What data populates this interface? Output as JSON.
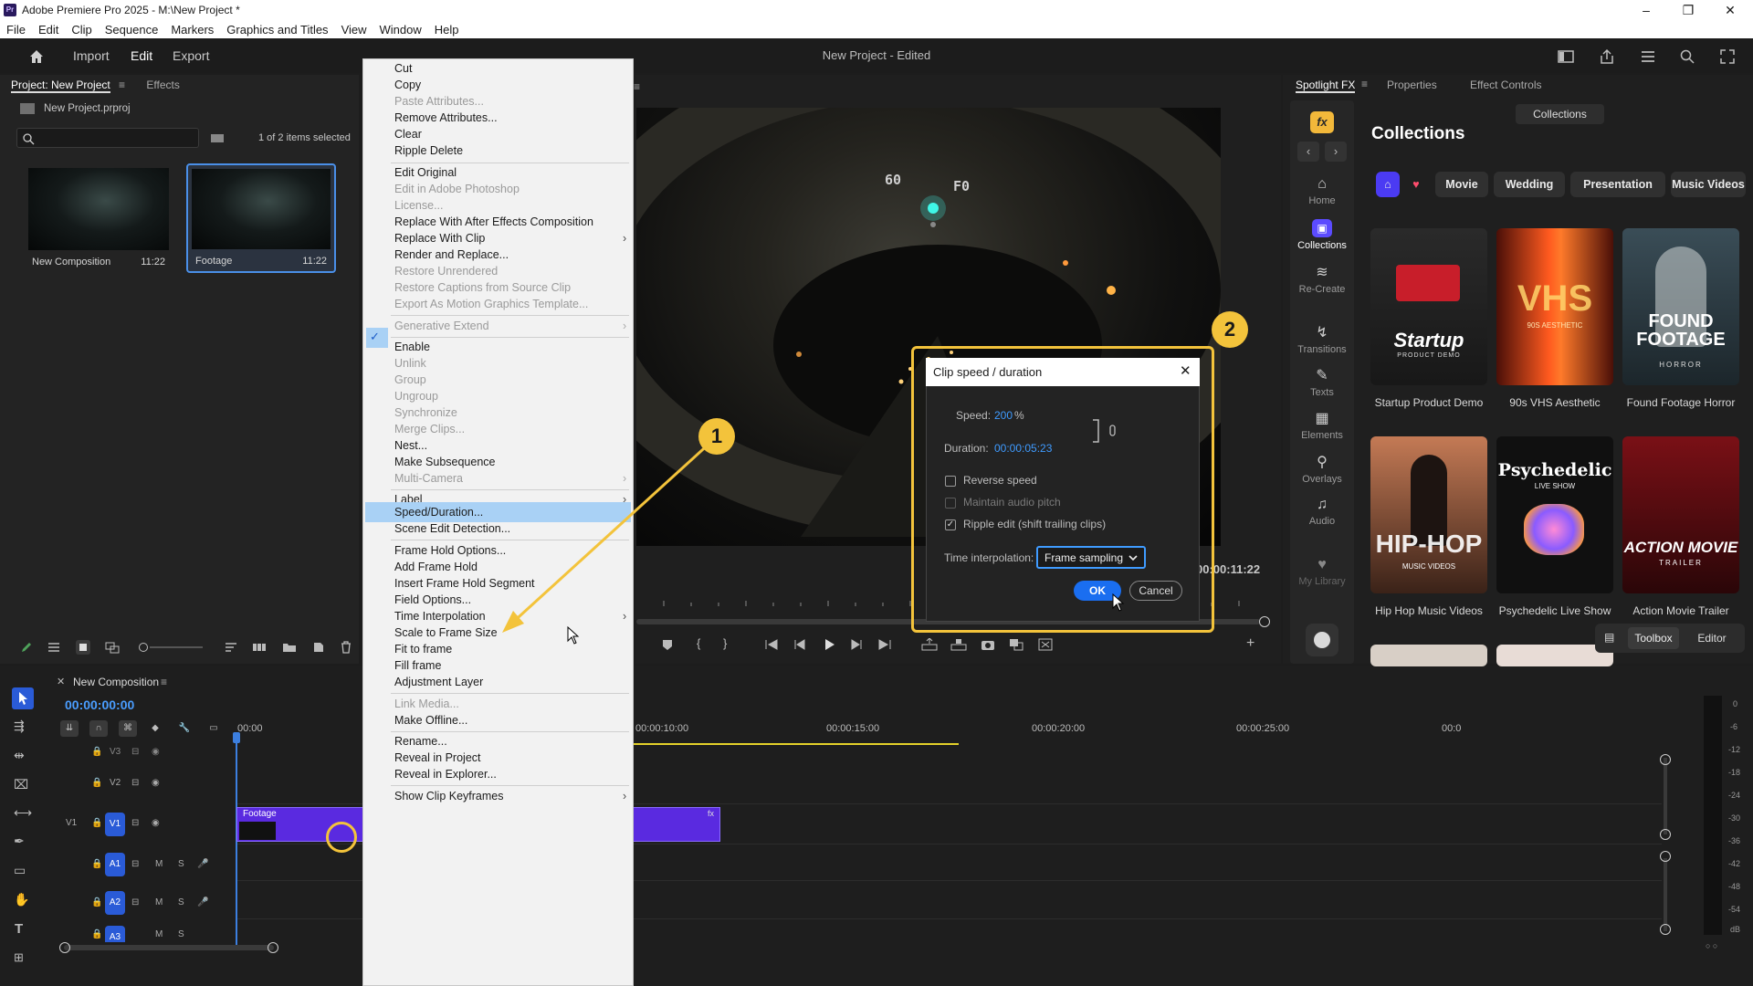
{
  "window": {
    "title": "Adobe Premiere Pro 2025 - M:\\New Project *",
    "logo": "Pr"
  },
  "menubar": [
    "File",
    "Edit",
    "Clip",
    "Sequence",
    "Markers",
    "Graphics and Titles",
    "View",
    "Window",
    "Help"
  ],
  "header": {
    "workspaces": {
      "import": "Import",
      "edit": "Edit",
      "export": "Export"
    },
    "project_title": "New Project - Edited"
  },
  "project_panel": {
    "tab_project": "Project: New Project",
    "tab_effects": "Effects",
    "file": "New Project.prproj",
    "selection_count": "1 of 2 items selected",
    "items": [
      {
        "name": "New Composition",
        "duration": "11:22"
      },
      {
        "name": "Footage",
        "duration": "11:22"
      }
    ]
  },
  "context_menu": {
    "items": {
      "cut": "Cut",
      "copy": "Copy",
      "paste_attr": "Paste Attributes...",
      "remove_attr": "Remove Attributes...",
      "clear": "Clear",
      "ripple_delete": "Ripple Delete",
      "edit_original": "Edit Original",
      "edit_photoshop": "Edit in Adobe Photoshop",
      "license": "License...",
      "replace_ae": "Replace With After Effects Composition",
      "replace_clip": "Replace With Clip",
      "render_replace": "Render and Replace...",
      "restore_unrendered": "Restore Unrendered",
      "restore_captions": "Restore Captions from Source Clip",
      "export_mogrt": "Export As Motion Graphics Template...",
      "generative_extend": "Generative Extend",
      "enable": "Enable",
      "unlink": "Unlink",
      "group": "Group",
      "ungroup": "Ungroup",
      "synchronize": "Synchronize",
      "merge_clips": "Merge Clips...",
      "nest": "Nest...",
      "make_subsequence": "Make Subsequence",
      "multi_camera": "Multi-Camera",
      "label": "Label",
      "speed_duration": "Speed/Duration...",
      "scene_edit": "Scene Edit Detection...",
      "frame_hold_options": "Frame Hold Options...",
      "add_frame_hold": "Add Frame Hold",
      "insert_frame_hold": "Insert Frame Hold Segment",
      "field_options": "Field Options...",
      "time_interpolation": "Time Interpolation",
      "scale_frame": "Scale to Frame Size",
      "fit_frame": "Fit to frame",
      "fill_frame": "Fill frame",
      "adjustment_layer": "Adjustment Layer",
      "link_media": "Link Media...",
      "make_offline": "Make Offline...",
      "rename": "Rename...",
      "reveal_project": "Reveal in Project",
      "reveal_explorer": "Reveal in Explorer...",
      "show_keyframes": "Show Clip Keyframes"
    }
  },
  "monitor": {
    "overlay_60": "60",
    "overlay_f0": "F0",
    "timecode": "00:00:11:22"
  },
  "dialog": {
    "title": "Clip speed / duration",
    "speed_label": "Speed:",
    "speed_value": "200",
    "speed_unit": "%",
    "duration_label": "Duration:",
    "duration_value": "00:00:05:23",
    "reverse_speed": "Reverse speed",
    "reverse_checked": false,
    "maintain_pitch": "Maintain audio pitch",
    "maintain_checked": false,
    "ripple_edit": "Ripple edit (shift trailing clips)",
    "ripple_checked": true,
    "interp_label": "Time interpolation:",
    "interp_value": "Frame sampling",
    "ok": "OK",
    "cancel": "Cancel"
  },
  "annotations": {
    "one": "1",
    "two": "2",
    "color": "#f3c33b"
  },
  "right_panel": {
    "tabs": {
      "spotlight": "Spotlight FX",
      "properties": "Properties",
      "effect_controls": "Effect Controls"
    },
    "collections_btn": "Collections",
    "heading": "Collections",
    "fx_label": "fx",
    "sidebar": [
      {
        "label": "Home",
        "icon": "home-icon"
      },
      {
        "label": "Collections",
        "icon": "collections-icon"
      },
      {
        "label": "Re-Create",
        "icon": "layers-icon"
      },
      {
        "label": "Transitions",
        "icon": "transitions-icon"
      },
      {
        "label": "Texts",
        "icon": "pen-icon"
      },
      {
        "label": "Elements",
        "icon": "elements-icon"
      },
      {
        "label": "Overlays",
        "icon": "overlays-icon"
      },
      {
        "label": "Audio",
        "icon": "music-icon"
      },
      {
        "label": "My Library",
        "icon": "heart-icon"
      }
    ],
    "chips": [
      "Movie",
      "Wedding",
      "Presentation",
      "Music Videos"
    ],
    "cards": [
      {
        "title": "Startup Product Demo",
        "art": "Startup",
        "art_sub": "PRODUCT DEMO"
      },
      {
        "title": "90s VHS Aesthetic",
        "art": "VHS",
        "art_sub": "90S AESTHETIC"
      },
      {
        "title": "Found Footage Horror",
        "art": "FOUND FOOTAGE",
        "art_sub": "HORROR"
      },
      {
        "title": "Hip Hop Music Videos",
        "art": "HIP-HOP",
        "art_sub": "MUSIC VIDEOS"
      },
      {
        "title": "Psychedelic Live Show",
        "art": "Psychedelic",
        "art_sub": "LIVE SHOW"
      },
      {
        "title": "Action Movie Trailer",
        "art": "ACTION MOVIE",
        "art_sub": "TRAILER"
      }
    ],
    "toolbox": "Toolbox",
    "editor": "Editor"
  },
  "timeline": {
    "sequence_name": "New Composition",
    "timecode": "00:00:00:00",
    "ruler": [
      "00:00",
      "00:00:10:00",
      "00:00:15:00",
      "00:00:20:00",
      "00:00:25:00",
      "00:0"
    ],
    "tracks": {
      "v3": "V3",
      "v2": "V2",
      "v1": "V1",
      "a1": "A1",
      "a2": "A2",
      "a3": "A3"
    },
    "clip_name": "Footage",
    "clip_fx": "fx",
    "meter_scale": [
      "0",
      "-6",
      "-12",
      "-18",
      "-24",
      "-30",
      "-36",
      "-42",
      "-48",
      "-54",
      "dB"
    ],
    "meter_solo": "S",
    "meter_bottom": "○ ○",
    "mute": "M",
    "solo": "S",
    "track_lock": "🔒"
  }
}
